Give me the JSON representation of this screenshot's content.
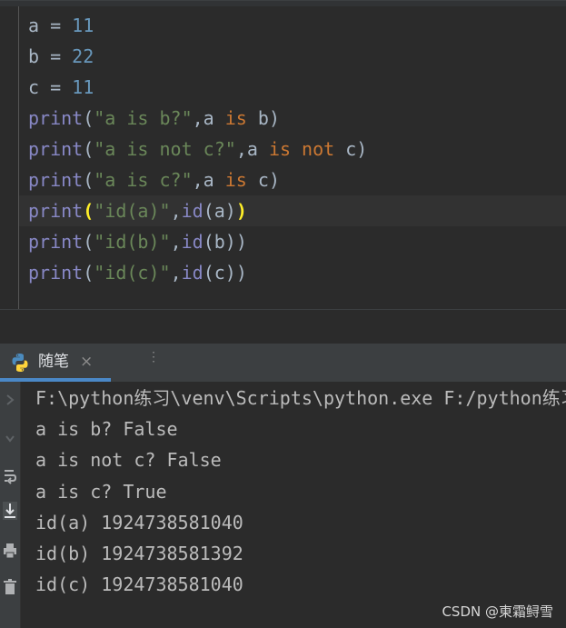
{
  "editor": {
    "lines": [
      [
        {
          "t": "a",
          "c": "var"
        },
        {
          "t": " = ",
          "c": "punc"
        },
        {
          "t": "11",
          "c": "num"
        }
      ],
      [
        {
          "t": "b",
          "c": "var"
        },
        {
          "t": " = ",
          "c": "punc"
        },
        {
          "t": "22",
          "c": "num"
        }
      ],
      [
        {
          "t": "c",
          "c": "var"
        },
        {
          "t": " = ",
          "c": "punc"
        },
        {
          "t": "11",
          "c": "num"
        }
      ],
      [
        {
          "t": "print",
          "c": "fn"
        },
        {
          "t": "(",
          "c": "punc"
        },
        {
          "t": "\"a is b?\"",
          "c": "str"
        },
        {
          "t": ",a ",
          "c": "punc"
        },
        {
          "t": "is",
          "c": "kw"
        },
        {
          "t": " b)",
          "c": "punc"
        }
      ],
      [
        {
          "t": "print",
          "c": "fn"
        },
        {
          "t": "(",
          "c": "punc"
        },
        {
          "t": "\"a is not c?\"",
          "c": "str"
        },
        {
          "t": ",a ",
          "c": "punc"
        },
        {
          "t": "is not",
          "c": "kw"
        },
        {
          "t": " c)",
          "c": "punc"
        }
      ],
      [
        {
          "t": "print",
          "c": "fn"
        },
        {
          "t": "(",
          "c": "punc"
        },
        {
          "t": "\"a is c?\"",
          "c": "str"
        },
        {
          "t": ",a ",
          "c": "punc"
        },
        {
          "t": "is",
          "c": "kw"
        },
        {
          "t": " c)",
          "c": "punc"
        }
      ],
      [
        {
          "t": "print",
          "c": "fn"
        },
        {
          "t": "(",
          "c": "brace-hl"
        },
        {
          "t": "\"id(a)\"",
          "c": "str"
        },
        {
          "t": ",",
          "c": "punc"
        },
        {
          "t": "id",
          "c": "fn"
        },
        {
          "t": "(a)",
          "c": "punc"
        },
        {
          "t": ")",
          "c": "brace-hl"
        }
      ],
      [
        {
          "t": "print",
          "c": "fn"
        },
        {
          "t": "(",
          "c": "punc"
        },
        {
          "t": "\"id(b)\"",
          "c": "str"
        },
        {
          "t": ",",
          "c": "punc"
        },
        {
          "t": "id",
          "c": "fn"
        },
        {
          "t": "(b))",
          "c": "punc"
        }
      ],
      [
        {
          "t": "print",
          "c": "fn"
        },
        {
          "t": "(",
          "c": "punc"
        },
        {
          "t": "\"id(c)\"",
          "c": "str"
        },
        {
          "t": ",",
          "c": "punc"
        },
        {
          "t": "id",
          "c": "fn"
        },
        {
          "t": "(c))",
          "c": "punc"
        }
      ]
    ],
    "current_line_index": 6
  },
  "run_panel": {
    "tab_label": "随笔",
    "tab_close": "×",
    "tab_icon": "python-icon",
    "toolbar_icons": [
      "rerun-icon",
      "stop-icon",
      "soft-wrap-icon",
      "scroll-to-end-icon",
      "print-icon",
      "delete-icon"
    ],
    "output": [
      "F:\\python练习\\venv\\Scripts\\python.exe F:/python练习/随笔.py",
      "a is b? False",
      "a is not c? False",
      "a is c? True",
      "id(a) 1924738581040",
      "id(b) 1924738581392",
      "id(c) 1924738581040"
    ]
  },
  "watermark": "CSDN @東霜鲟雪",
  "colors": {
    "number": "#6897bb",
    "string": "#6a8759",
    "keyword": "#cc7832",
    "builtin": "#8888c6",
    "text": "#a9b7c6",
    "brace_highlight": "#ffef28",
    "accent": "#4a88c7"
  }
}
